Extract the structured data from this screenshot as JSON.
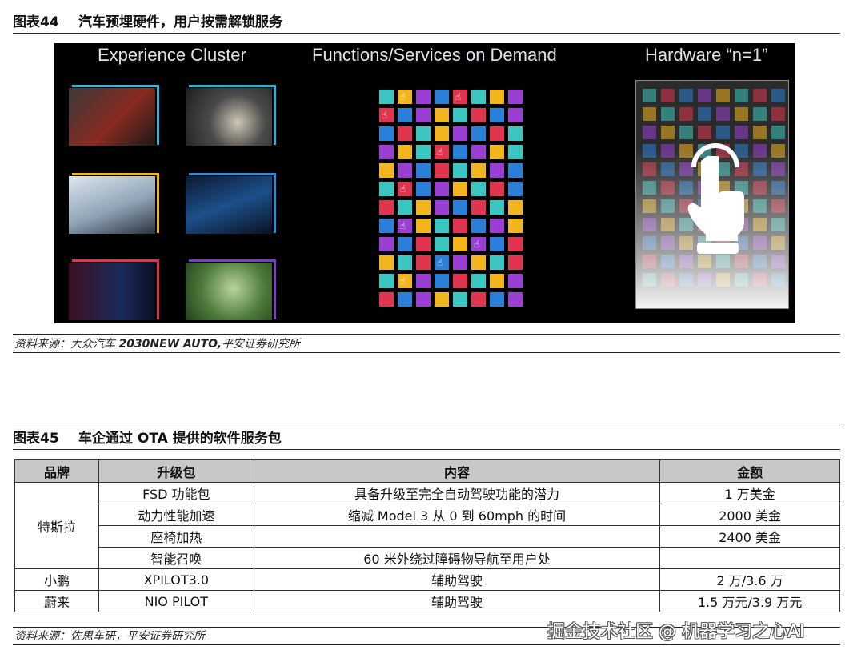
{
  "fig44": {
    "number": "图表44",
    "title": "汽车预埋硬件，用户按需解锁服务",
    "image": {
      "col1_heading": "Experience Cluster",
      "col2_heading": "Functions/Services on Demand",
      "col3_heading": "Hardware “n=1”",
      "thumb_accent_colors": [
        "#3bb0d6",
        "#3bb0d6",
        "#f2b51d",
        "#2a8fd6",
        "#e0344f",
        "#7b3fc4"
      ],
      "grid_palette": [
        "#3cc6c1",
        "#2a7fd9",
        "#f2b51d",
        "#e0344f",
        "#9b3fd4"
      ]
    },
    "source_prefix": "资料来源：大众汽车 ",
    "source_bold": "2030NEW AUTO,",
    "source_suffix": "平安证券研究所"
  },
  "fig45": {
    "number": "图表45",
    "title": "车企通过 OTA 提供的软件服务包",
    "headers": [
      "品牌",
      "升级包",
      "内容",
      "金额"
    ],
    "rows": [
      {
        "brand": "特斯拉",
        "package": "FSD 功能包",
        "content": "具备升级至完全自动驾驶功能的潜力",
        "price": "1 万美金"
      },
      {
        "brand": "",
        "package": "动力性能加速",
        "content": "缩减 Model 3 从 0 到 60mph 的时间",
        "price": "2000 美金"
      },
      {
        "brand": "",
        "package": "座椅加热",
        "content": "",
        "price": "2400 美金"
      },
      {
        "brand": "",
        "package": "智能召唤",
        "content": "60 米外绕过障碍物导航至用户处",
        "price": ""
      },
      {
        "brand": "小鹏",
        "package": "XPILOT3.0",
        "content": "辅助驾驶",
        "price": "2 万/3.6 万"
      },
      {
        "brand": "蔚来",
        "package": "NIO PILOT",
        "content": "辅助驾驶",
        "price": "1.5 万元/3.9 万元"
      }
    ],
    "source": "资料来源：佐思车研，平安证券研究所"
  },
  "watermark": "掘金技术社区 @ 机器学习之心AI"
}
